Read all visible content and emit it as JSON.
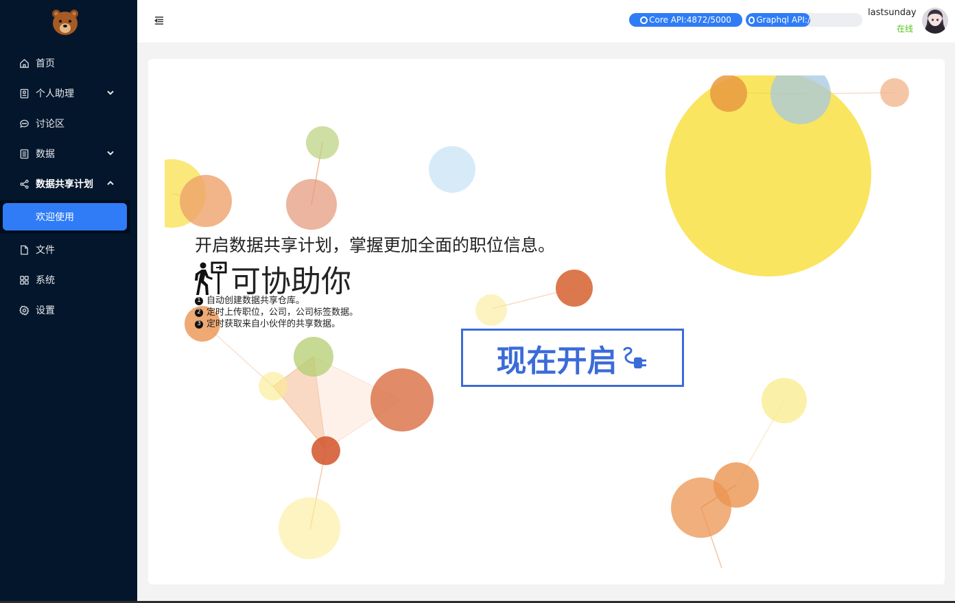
{
  "sidebar": {
    "items": [
      {
        "label": "首页",
        "icon": "home-icon"
      },
      {
        "label": "个人助理",
        "icon": "assistant-icon"
      },
      {
        "label": "讨论区",
        "icon": "chat-icon"
      },
      {
        "label": "数据",
        "icon": "database-icon"
      },
      {
        "label": "数据共享计划",
        "icon": "share-icon"
      },
      {
        "label": "欢迎使用"
      },
      {
        "label": "文件",
        "icon": "file-icon"
      },
      {
        "label": "系统",
        "icon": "apps-icon"
      },
      {
        "label": "设置",
        "icon": "gear-icon"
      }
    ]
  },
  "header": {
    "core_api": "Core API:4872/5000",
    "graphql_api": "Graphql API:/",
    "username": "lastsunday",
    "status": "在线"
  },
  "main": {
    "headline": "开启数据共享计划，掌握更加全面的职位信息。",
    "subhead": "可协助你",
    "steps": [
      {
        "num": "1",
        "text": "自动创建数据共享仓库。"
      },
      {
        "num": "2",
        "text": "定时上传职位，公司，公司标签数据。"
      },
      {
        "num": "3",
        "text": "定时获取来自小伙伴的共享数据。"
      }
    ],
    "cta_label": "现在开启"
  },
  "colors": {
    "sidebar_bg": "#04162b",
    "accent": "#2f7cf6",
    "online": "#52c41a",
    "cta": "#3b6bd9"
  }
}
